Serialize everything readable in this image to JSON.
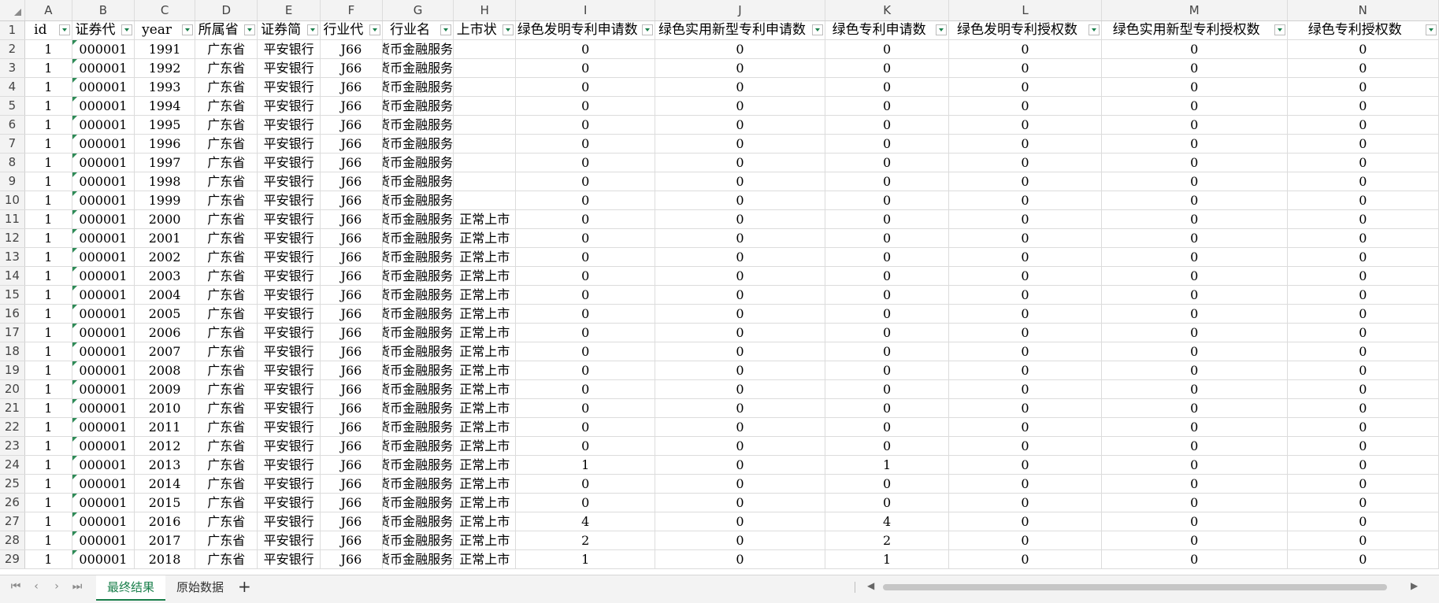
{
  "sheet": {
    "columns": [
      "A",
      "B",
      "C",
      "D",
      "E",
      "F",
      "G",
      "H",
      "I",
      "J",
      "K",
      "L",
      "M",
      "N"
    ],
    "headers": [
      "id",
      "证券代",
      "year",
      "所属省",
      "证券简",
      "行业代",
      "行业名",
      "上市状",
      "绿色发明专利申请数",
      "绿色实用新型专利申请数",
      "绿色专利申请数",
      "绿色发明专利授权数",
      "绿色实用新型专利授权数",
      "绿色专利授权数"
    ],
    "rows": [
      {
        "n": "2",
        "id": "1",
        "code": "000001",
        "year": "1991",
        "prov": "广东省",
        "name": "平安银行",
        "ind": "J66",
        "indname": "货币金融服务",
        "status": "",
        "I": "0",
        "J": "0",
        "K": "0",
        "L": "0",
        "M": "0",
        "N": "0"
      },
      {
        "n": "3",
        "id": "1",
        "code": "000001",
        "year": "1992",
        "prov": "广东省",
        "name": "平安银行",
        "ind": "J66",
        "indname": "货币金融服务",
        "status": "",
        "I": "0",
        "J": "0",
        "K": "0",
        "L": "0",
        "M": "0",
        "N": "0"
      },
      {
        "n": "4",
        "id": "1",
        "code": "000001",
        "year": "1993",
        "prov": "广东省",
        "name": "平安银行",
        "ind": "J66",
        "indname": "货币金融服务",
        "status": "",
        "I": "0",
        "J": "0",
        "K": "0",
        "L": "0",
        "M": "0",
        "N": "0"
      },
      {
        "n": "5",
        "id": "1",
        "code": "000001",
        "year": "1994",
        "prov": "广东省",
        "name": "平安银行",
        "ind": "J66",
        "indname": "货币金融服务",
        "status": "",
        "I": "0",
        "J": "0",
        "K": "0",
        "L": "0",
        "M": "0",
        "N": "0"
      },
      {
        "n": "6",
        "id": "1",
        "code": "000001",
        "year": "1995",
        "prov": "广东省",
        "name": "平安银行",
        "ind": "J66",
        "indname": "货币金融服务",
        "status": "",
        "I": "0",
        "J": "0",
        "K": "0",
        "L": "0",
        "M": "0",
        "N": "0"
      },
      {
        "n": "7",
        "id": "1",
        "code": "000001",
        "year": "1996",
        "prov": "广东省",
        "name": "平安银行",
        "ind": "J66",
        "indname": "货币金融服务",
        "status": "",
        "I": "0",
        "J": "0",
        "K": "0",
        "L": "0",
        "M": "0",
        "N": "0"
      },
      {
        "n": "8",
        "id": "1",
        "code": "000001",
        "year": "1997",
        "prov": "广东省",
        "name": "平安银行",
        "ind": "J66",
        "indname": "货币金融服务",
        "status": "",
        "I": "0",
        "J": "0",
        "K": "0",
        "L": "0",
        "M": "0",
        "N": "0"
      },
      {
        "n": "9",
        "id": "1",
        "code": "000001",
        "year": "1998",
        "prov": "广东省",
        "name": "平安银行",
        "ind": "J66",
        "indname": "货币金融服务",
        "status": "",
        "I": "0",
        "J": "0",
        "K": "0",
        "L": "0",
        "M": "0",
        "N": "0"
      },
      {
        "n": "10",
        "id": "1",
        "code": "000001",
        "year": "1999",
        "prov": "广东省",
        "name": "平安银行",
        "ind": "J66",
        "indname": "货币金融服务",
        "status": "",
        "I": "0",
        "J": "0",
        "K": "0",
        "L": "0",
        "M": "0",
        "N": "0"
      },
      {
        "n": "11",
        "id": "1",
        "code": "000001",
        "year": "2000",
        "prov": "广东省",
        "name": "平安银行",
        "ind": "J66",
        "indname": "货币金融服务",
        "status": "正常上市",
        "I": "0",
        "J": "0",
        "K": "0",
        "L": "0",
        "M": "0",
        "N": "0"
      },
      {
        "n": "12",
        "id": "1",
        "code": "000001",
        "year": "2001",
        "prov": "广东省",
        "name": "平安银行",
        "ind": "J66",
        "indname": "货币金融服务",
        "status": "正常上市",
        "I": "0",
        "J": "0",
        "K": "0",
        "L": "0",
        "M": "0",
        "N": "0"
      },
      {
        "n": "13",
        "id": "1",
        "code": "000001",
        "year": "2002",
        "prov": "广东省",
        "name": "平安银行",
        "ind": "J66",
        "indname": "货币金融服务",
        "status": "正常上市",
        "I": "0",
        "J": "0",
        "K": "0",
        "L": "0",
        "M": "0",
        "N": "0"
      },
      {
        "n": "14",
        "id": "1",
        "code": "000001",
        "year": "2003",
        "prov": "广东省",
        "name": "平安银行",
        "ind": "J66",
        "indname": "货币金融服务",
        "status": "正常上市",
        "I": "0",
        "J": "0",
        "K": "0",
        "L": "0",
        "M": "0",
        "N": "0"
      },
      {
        "n": "15",
        "id": "1",
        "code": "000001",
        "year": "2004",
        "prov": "广东省",
        "name": "平安银行",
        "ind": "J66",
        "indname": "货币金融服务",
        "status": "正常上市",
        "I": "0",
        "J": "0",
        "K": "0",
        "L": "0",
        "M": "0",
        "N": "0"
      },
      {
        "n": "16",
        "id": "1",
        "code": "000001",
        "year": "2005",
        "prov": "广东省",
        "name": "平安银行",
        "ind": "J66",
        "indname": "货币金融服务",
        "status": "正常上市",
        "I": "0",
        "J": "0",
        "K": "0",
        "L": "0",
        "M": "0",
        "N": "0"
      },
      {
        "n": "17",
        "id": "1",
        "code": "000001",
        "year": "2006",
        "prov": "广东省",
        "name": "平安银行",
        "ind": "J66",
        "indname": "货币金融服务",
        "status": "正常上市",
        "I": "0",
        "J": "0",
        "K": "0",
        "L": "0",
        "M": "0",
        "N": "0"
      },
      {
        "n": "18",
        "id": "1",
        "code": "000001",
        "year": "2007",
        "prov": "广东省",
        "name": "平安银行",
        "ind": "J66",
        "indname": "货币金融服务",
        "status": "正常上市",
        "I": "0",
        "J": "0",
        "K": "0",
        "L": "0",
        "M": "0",
        "N": "0"
      },
      {
        "n": "19",
        "id": "1",
        "code": "000001",
        "year": "2008",
        "prov": "广东省",
        "name": "平安银行",
        "ind": "J66",
        "indname": "货币金融服务",
        "status": "正常上市",
        "I": "0",
        "J": "0",
        "K": "0",
        "L": "0",
        "M": "0",
        "N": "0"
      },
      {
        "n": "20",
        "id": "1",
        "code": "000001",
        "year": "2009",
        "prov": "广东省",
        "name": "平安银行",
        "ind": "J66",
        "indname": "货币金融服务",
        "status": "正常上市",
        "I": "0",
        "J": "0",
        "K": "0",
        "L": "0",
        "M": "0",
        "N": "0"
      },
      {
        "n": "21",
        "id": "1",
        "code": "000001",
        "year": "2010",
        "prov": "广东省",
        "name": "平安银行",
        "ind": "J66",
        "indname": "货币金融服务",
        "status": "正常上市",
        "I": "0",
        "J": "0",
        "K": "0",
        "L": "0",
        "M": "0",
        "N": "0"
      },
      {
        "n": "22",
        "id": "1",
        "code": "000001",
        "year": "2011",
        "prov": "广东省",
        "name": "平安银行",
        "ind": "J66",
        "indname": "货币金融服务",
        "status": "正常上市",
        "I": "0",
        "J": "0",
        "K": "0",
        "L": "0",
        "M": "0",
        "N": "0"
      },
      {
        "n": "23",
        "id": "1",
        "code": "000001",
        "year": "2012",
        "prov": "广东省",
        "name": "平安银行",
        "ind": "J66",
        "indname": "货币金融服务",
        "status": "正常上市",
        "I": "0",
        "J": "0",
        "K": "0",
        "L": "0",
        "M": "0",
        "N": "0"
      },
      {
        "n": "24",
        "id": "1",
        "code": "000001",
        "year": "2013",
        "prov": "广东省",
        "name": "平安银行",
        "ind": "J66",
        "indname": "货币金融服务",
        "status": "正常上市",
        "I": "1",
        "J": "0",
        "K": "1",
        "L": "0",
        "M": "0",
        "N": "0"
      },
      {
        "n": "25",
        "id": "1",
        "code": "000001",
        "year": "2014",
        "prov": "广东省",
        "name": "平安银行",
        "ind": "J66",
        "indname": "货币金融服务",
        "status": "正常上市",
        "I": "0",
        "J": "0",
        "K": "0",
        "L": "0",
        "M": "0",
        "N": "0"
      },
      {
        "n": "26",
        "id": "1",
        "code": "000001",
        "year": "2015",
        "prov": "广东省",
        "name": "平安银行",
        "ind": "J66",
        "indname": "货币金融服务",
        "status": "正常上市",
        "I": "0",
        "J": "0",
        "K": "0",
        "L": "0",
        "M": "0",
        "N": "0"
      },
      {
        "n": "27",
        "id": "1",
        "code": "000001",
        "year": "2016",
        "prov": "广东省",
        "name": "平安银行",
        "ind": "J66",
        "indname": "货币金融服务",
        "status": "正常上市",
        "I": "4",
        "J": "0",
        "K": "4",
        "L": "0",
        "M": "0",
        "N": "0"
      },
      {
        "n": "28",
        "id": "1",
        "code": "000001",
        "year": "2017",
        "prov": "广东省",
        "name": "平安银行",
        "ind": "J66",
        "indname": "货币金融服务",
        "status": "正常上市",
        "I": "2",
        "J": "0",
        "K": "2",
        "L": "0",
        "M": "0",
        "N": "0"
      },
      {
        "n": "29",
        "id": "1",
        "code": "000001",
        "year": "2018",
        "prov": "广东省",
        "name": "平安银行",
        "ind": "J66",
        "indname": "货币金融服务",
        "status": "正常上市",
        "I": "1",
        "J": "0",
        "K": "1",
        "L": "0",
        "M": "0",
        "N": "0"
      }
    ]
  },
  "tabs": {
    "active": "最终结果",
    "other": "原始数据",
    "add_icon": "+",
    "nav_first": "⏮",
    "nav_prev": "‹",
    "nav_next": "›",
    "nav_last": "⏭"
  },
  "colors": {
    "accent": "#1a7f4b",
    "grid": "#dcdcdc",
    "header_bg": "#f3f3f3"
  }
}
